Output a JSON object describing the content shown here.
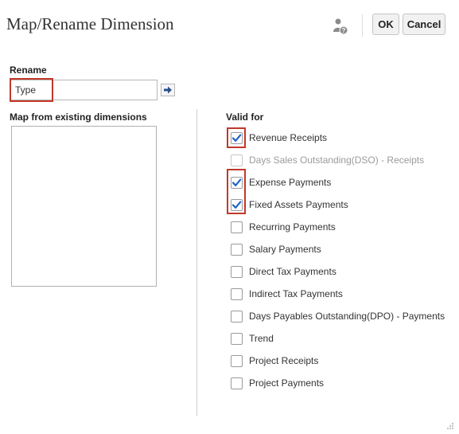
{
  "dialog": {
    "title": "Map/Rename Dimension",
    "ok_label": "OK",
    "cancel_label": "Cancel",
    "help_icon": "user-help-icon"
  },
  "rename": {
    "label": "Rename",
    "value": "Type",
    "go_icon": "arrow-right-icon"
  },
  "map": {
    "label": "Map from existing dimensions",
    "items": []
  },
  "valid_for": {
    "label": "Valid for",
    "items": [
      {
        "label": "Revenue Receipts",
        "checked": true,
        "enabled": true
      },
      {
        "label": "Days Sales Outstanding(DSO) - Receipts",
        "checked": false,
        "enabled": false
      },
      {
        "label": "Expense Payments",
        "checked": true,
        "enabled": true
      },
      {
        "label": "Fixed Assets Payments",
        "checked": true,
        "enabled": true
      },
      {
        "label": "Recurring Payments",
        "checked": false,
        "enabled": true
      },
      {
        "label": "Salary Payments",
        "checked": false,
        "enabled": true
      },
      {
        "label": "Direct Tax Payments",
        "checked": false,
        "enabled": true
      },
      {
        "label": "Indirect Tax Payments",
        "checked": false,
        "enabled": true
      },
      {
        "label": "Days Payables Outstanding(DPO) - Payments",
        "checked": false,
        "enabled": true
      },
      {
        "label": "Trend",
        "checked": false,
        "enabled": true
      },
      {
        "label": "Project Receipts",
        "checked": false,
        "enabled": true
      },
      {
        "label": "Project Payments",
        "checked": false,
        "enabled": true
      }
    ]
  },
  "colors": {
    "check_blue": "#1f63c6",
    "highlight_red": "#c0392b"
  }
}
